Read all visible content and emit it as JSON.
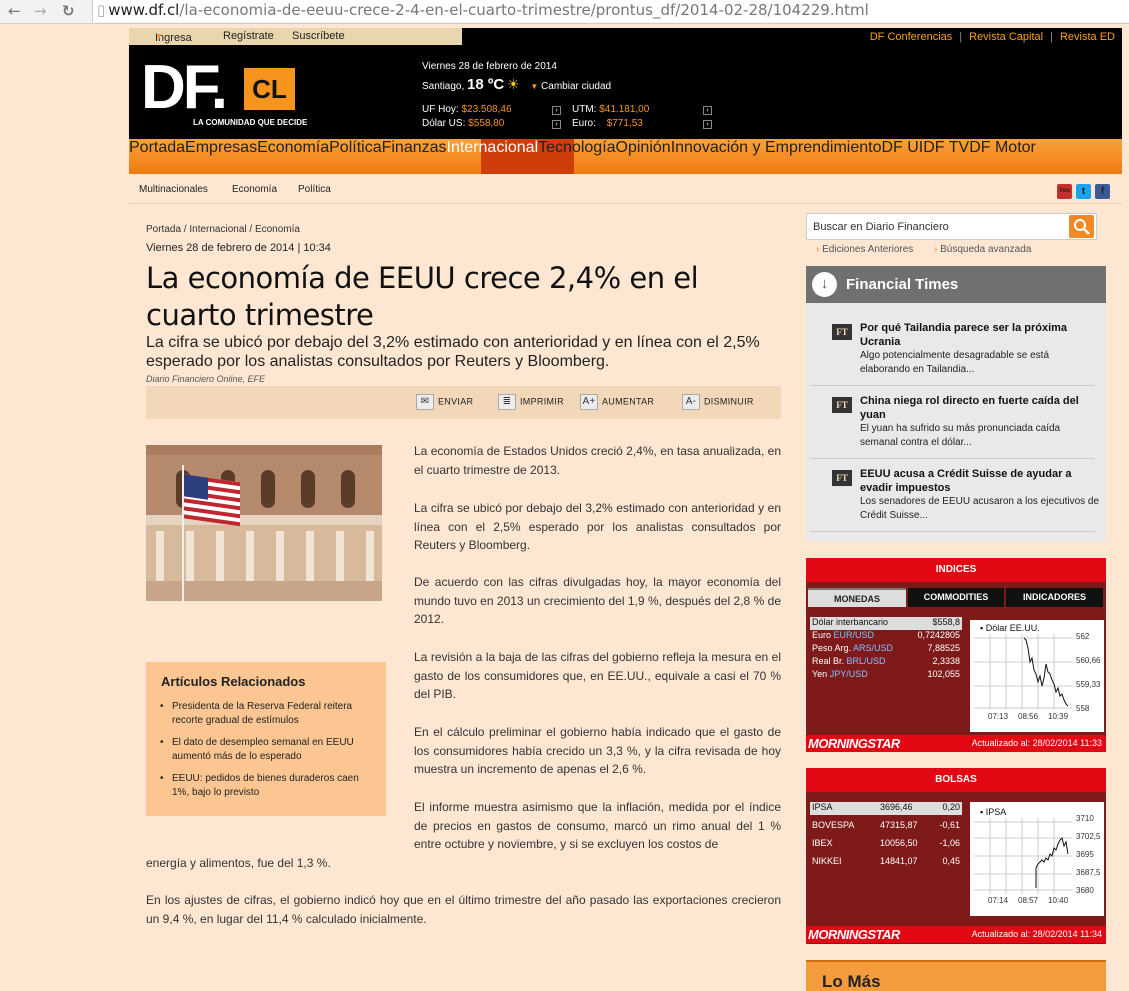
{
  "browser": {
    "url_host": "www.df.cl",
    "url_path": "/la-economia-de-eeuu-crece-2-4-en-el-cuarto-trimestre/prontus_df/2014-02-28/104229.html",
    "back": "←",
    "forward": "→",
    "reload": "↻",
    "page_icon": "▯"
  },
  "top_links": {
    "ingresa": "Ingresa",
    "registrate": "Regístrate",
    "suscribete": "Suscríbete"
  },
  "right_links": [
    "DF Conferencias",
    "Revista Capital",
    "Revista ED"
  ],
  "right_links_sep": "|",
  "logo": {
    "df": "DF.",
    "cl": "CL",
    "tagline": "LA COMUNIDAD QUE DECIDE"
  },
  "header": {
    "date": "Viernes 28 de febrero de 2014",
    "city": "Santiago,",
    "temp": "18 ºC",
    "change_city": "Cambiar ciudad",
    "uf_label": "UF Hoy:",
    "uf_value": "$23.508,46",
    "dolar_label": "Dólar US:",
    "dolar_value": "$558,80",
    "utm_label": "UTM:",
    "utm_value": "$41.181,00",
    "euro_label": "Euro:",
    "euro_value": "$771,53"
  },
  "nav": [
    "Portada",
    "Empresas",
    "Economía",
    "Política",
    "Finanzas",
    "Internacional",
    "Tecnología",
    "Opinión",
    "Innovación y Emprendimiento",
    "DF UI",
    "DF TV",
    "DF Motor"
  ],
  "subnav": [
    "Multinacionales",
    "Economía",
    "Política"
  ],
  "social": {
    "youtube": "You",
    "twitter": "t",
    "facebook": "f"
  },
  "article": {
    "breadcrumb": "Portada / Internacional / Economía",
    "datetime": "Viernes 28 de febrero de 2014 | 10:34",
    "title": "La economía de EEUU crece 2,4% en el cuarto trimestre",
    "lead": "La cifra se ubicó por debajo del 3,2% estimado con anterioridad y en línea con el 2,5% esperado por los analistas consultados por Reuters y Bloomberg.",
    "source": "Diario Financiero Online, EFE",
    "tools": {
      "send": "ENVIAR",
      "print": "IMPRIMIR",
      "increase": "AUMENTAR",
      "decrease": "DISMINUIR",
      "increase_icon": "A+",
      "decrease_icon": "A-"
    },
    "paragraphs": [
      "La economía de Estados Unidos creció 2,4%, en tasa anualizada, en el cuarto trimestre de 2013.",
      "La cifra se ubicó por debajo del 3,2% estimado con anterioridad y en línea con el 2,5% esperado por los analistas consultados por Reuters y Bloomberg.",
      "De acuerdo con las cifras divulgadas hoy, la mayor economía del mundo tuvo en 2013 un crecimiento del 1,9 %, después del 2,8 % de 2012.",
      "La revisión a la baja de las cifras del gobierno refleja la mesura en el gasto de los consumidores que, en EE.UU., equivale a casi el 70 % del PIB.",
      "En el cálculo preliminar el gobierno había indicado que el gasto de los consumidores había crecido un 3,3 %, y la cifra revisada de hoy muestra un incremento de apenas el 2,6 %.",
      "El informe muestra asimismo que la inflación, medida por el índice de precios en gastos de consumo, marcó un rimo anual del 1 % entre octubre y noviembre, y si se excluyen los costos de",
      "energía y alimentos, fue del 1,3 %.",
      "En los ajustes de cifras, el gobierno indicó hoy que en el último trimestre del año pasado las exportaciones crecieron un 9,4 %, en lugar del 11,4 % calculado inicialmente."
    ],
    "related_title": "Artículos Relacionados",
    "related": [
      "Presidenta de la Reserva Federal reitera recorte gradual de estímulos",
      "El dato de desempleo semanal en EEUU aumentó más de lo esperado",
      "EEUU: pedidos de bienes duraderos caen 1%, bajo lo previsto"
    ]
  },
  "sidebar": {
    "search_placeholder": "Buscar en Diario Financiero",
    "ediciones": "Ediciones Anteriores",
    "busqueda": "Búsqueda avanzada",
    "ft_title": "Financial Times",
    "ft_logo": "FT",
    "ft_items": [
      {
        "title": "Por qué Tailandia parece ser la próxima Ucrania",
        "desc": "Algo potencialmente desagradable se está elaborando en Tailandia..."
      },
      {
        "title": "China niega rol directo en fuerte caída del yuan",
        "desc": "El yuan ha sufrido su más pronunciada caída semanal contra el dólar..."
      },
      {
        "title": "EEUU acusa a Crédit Suisse de ayudar a evadir impuestos",
        "desc": "Los senadores de EEUU acusaron a los ejecutivos de Crédit Suisse..."
      }
    ],
    "indices": {
      "title": "INDICES",
      "tabs": [
        "MONEDAS",
        "COMMODITIES",
        "INDICADORES"
      ],
      "rows": [
        {
          "label": "Dólar interbancario",
          "code": "",
          "value": "$558,8"
        },
        {
          "label": "Euro",
          "code": "EUR/USD",
          "value": "0,7242805"
        },
        {
          "label": "Peso Arg.",
          "code": "ARS/USD",
          "value": "7,88525"
        },
        {
          "label": "Real Br.",
          "code": "BRL/USD",
          "value": "2,3338"
        },
        {
          "label": "Yen",
          "code": "JPY/USD",
          "value": "102,055"
        }
      ],
      "chart_label": "Dólar EE.UU.",
      "y_ticks": [
        "562",
        "560,66",
        "559,33",
        "558"
      ],
      "x_ticks": [
        "07:13",
        "08:56",
        "10:39"
      ],
      "logo": "MORNINGSTAR",
      "updated": "Actualizado al: 28/02/2014 11:33"
    },
    "bolsas": {
      "title": "BOLSAS",
      "rows": [
        {
          "name": "IPSA",
          "value": "3696,46",
          "change": "0,20"
        },
        {
          "name": "BOVESPA",
          "value": "47315,87",
          "change": "-0,61"
        },
        {
          "name": "IBEX",
          "value": "10056,50",
          "change": "-1,06"
        },
        {
          "name": "NIKKEI",
          "value": "14841,07",
          "change": "0,45"
        }
      ],
      "chart_label": "IPSA",
      "y_ticks": [
        "3710",
        "3702,5",
        "3695",
        "3687,5",
        "3680"
      ],
      "x_ticks": [
        "07:14",
        "08:57",
        "10:40"
      ],
      "logo": "MORNINGSTAR",
      "updated": "Actualizado al: 28/02/2014 11:34"
    },
    "lo_mas": "Lo Más"
  }
}
